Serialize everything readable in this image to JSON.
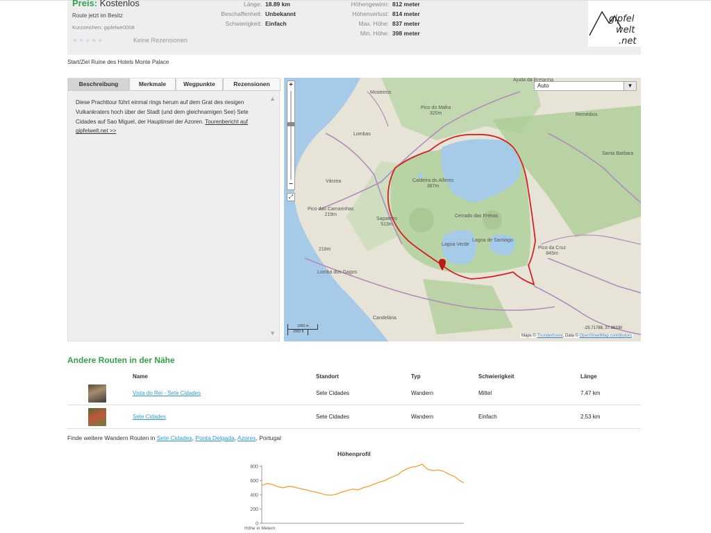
{
  "header": {
    "price_label": "Preis:",
    "price_value": "Kostenlos",
    "owned": "Route jetzt im Besitz",
    "code": "Kurzzeichen: gipfelwe0008",
    "stars": "★★★★★",
    "no_reviews": "Keine Rezensionen",
    "stats_left": [
      {
        "key": "Länge:",
        "value": "18.89 km"
      },
      {
        "key": "Beschaffenheit:",
        "value": "Unbekannt"
      },
      {
        "key": "Schwierigkeit:",
        "value": "Einfach"
      }
    ],
    "stats_right": [
      {
        "key": "Höhengewinn:",
        "value": "812 meter"
      },
      {
        "key": "Höhenverlust:",
        "value": "814 meter"
      },
      {
        "key": "Max. Höhe:",
        "value": "837 meter"
      },
      {
        "key": "Min. Höhe:",
        "value": "398 meter"
      }
    ],
    "logo_text": "gipfel welt .net"
  },
  "start_ziel": "Start/Ziel Ruine des Hotels Monte Palace",
  "tabs": [
    "Beschreibung",
    "Merkmale",
    "Wegpunkte",
    "Rezensionen"
  ],
  "description": {
    "text": "Diese Prachttour führt einmal rings herum auf dem Grat des riesigen Vulkankraters hoch über der Stadt (und dem gleichnamigen See) Sete Cidades auf Sao Miguel, der Hauptinsel der Azoren.",
    "link": "Tourenbericht auf gipfelwelt.net >>"
  },
  "map": {
    "layer": "Auto",
    "scale_m": "1000 m",
    "scale_ft": "2000 ft",
    "attribution_prefix": "Maps ©",
    "attribution_link": "Thunderforest",
    "attribution_mid": ", Data ©",
    "attribution_link2": "OpenStreetMap contributors",
    "coords": "-25.71788, 37.86330",
    "labels": {
      "ajuda": "Ajuda da Bretanha",
      "mosteiros": "Mosteiros",
      "pico_mafra": "Pico do Mafra",
      "pico_mafra_h": "320m",
      "remedios": "Remédios",
      "lombas": "Lombas",
      "santa_barbara": "Santa Barbara",
      "varzea": "Várzea",
      "caldeira": "Caldeira do Alferes",
      "caldeira_h": "387m",
      "pico_camarinhas": "Pico das Camarinhas",
      "pico_camarinhas_h": "219m",
      "sape": "Sapateiro",
      "sape_h": "513m",
      "cerrado": "Cerrado das Freiras",
      "lagoa_santiago": "Lagoa de Santiago",
      "lagoa_verde": "Lagoa Verde",
      "pico_cruz": "Pico da Cruz",
      "pico_cruz_h": "845m",
      "m218": "218m",
      "lomba_gagos": "Lomba dos Gagos",
      "candelaria": "Candelária"
    }
  },
  "nearby": {
    "title": "Andere Routen in der Nähe",
    "columns": [
      "Name",
      "Standort",
      "Typ",
      "Schwierigkeit",
      "Länge"
    ],
    "rows": [
      {
        "name": "Vista do Rei - Sete Cidades",
        "location": "Sete Cidades",
        "type": "Wandern",
        "difficulty": "Mittel",
        "length": "7.47 km"
      },
      {
        "name": "Sete Cidades",
        "location": "Sete Cidades",
        "type": "Wandern",
        "difficulty": "Einfach",
        "length": "2.53 km"
      }
    ]
  },
  "more_routes": {
    "prefix": "Finde weitere Wandern Routen in",
    "links": [
      "Sete Cidades",
      "Ponta Delgada",
      "Azores"
    ],
    "suffix": "Portugal"
  },
  "chart_data": {
    "type": "line",
    "title": "Höhenprofil",
    "ylabel": "Höhe in Metern",
    "ylim": [
      0,
      800
    ],
    "yticks": [
      0,
      200,
      400,
      600,
      800
    ],
    "x": [
      0,
      0.5,
      1,
      1.5,
      2,
      2.5,
      3,
      3.5,
      4,
      4.5,
      5,
      5.5,
      6,
      6.5,
      7,
      7.5,
      8,
      8.5,
      9,
      9.5,
      10,
      10.5,
      11,
      11.5,
      12,
      12.5,
      12.8,
      13,
      13.5,
      14,
      14.5,
      15,
      15.5,
      16,
      16.5,
      17,
      17.5,
      18,
      18.5,
      18.89
    ],
    "series": [
      {
        "values": [
          530,
          560,
          545,
          515,
          500,
          520,
          510,
          490,
          475,
          455,
          440,
          420,
          400,
          395,
          410,
          440,
          460,
          480,
          470,
          500,
          520,
          550,
          580,
          600,
          640,
          670,
          690,
          720,
          760,
          790,
          800,
          830,
          760,
          740,
          750,
          730,
          690,
          660,
          600,
          570
        ]
      }
    ]
  }
}
